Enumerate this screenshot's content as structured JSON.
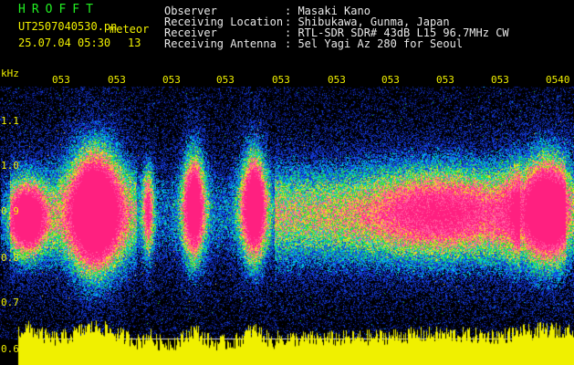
{
  "header": {
    "program": "HROFFT",
    "filename": "UT2507040530.pn",
    "mode": "meteor",
    "datetime": "25.07.04 05:30",
    "count": "13",
    "observer_label": "Observer",
    "observer_value": ": Masaki Kano",
    "location_label": "Receiving Location",
    "location_value": ": Shibukawa, Gunma, Japan",
    "receiver_label": "Receiver",
    "receiver_value": ": RTL-SDR SDR# 43dB L15 96.7MHz CW",
    "antenna_label": "Receiving Antenna",
    "antenna_value": ": 5el Yagi Az 280 for Seoul"
  },
  "axes": {
    "y_unit": "kHz",
    "y_ticks": [
      "1.1",
      "1.0",
      "0.9",
      "0.8",
      "0.7",
      "0.6"
    ],
    "x_ticks": [
      "053",
      "053",
      "053",
      "053",
      "053",
      "053",
      "053",
      "053",
      "053",
      "0540"
    ]
  },
  "colors": {
    "label": "#f0f000",
    "program": "#22ee22",
    "hot": "#ff2080",
    "noise_blue": "#1030c0",
    "power_trace": "#f0f000"
  }
}
